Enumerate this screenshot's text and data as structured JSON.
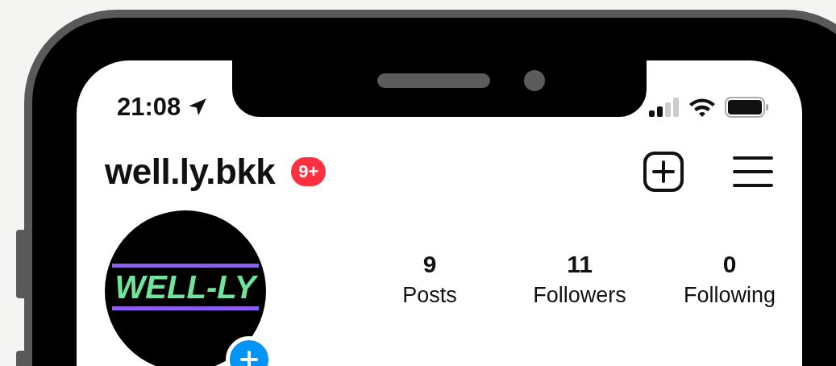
{
  "status_bar": {
    "time": "21:08"
  },
  "header": {
    "username": "well.ly.bkk",
    "badge": "9+"
  },
  "profile": {
    "avatar_logo": "WELL-LY"
  },
  "stats": [
    {
      "value": "9",
      "label": "Posts"
    },
    {
      "value": "11",
      "label": "Followers"
    },
    {
      "value": "0",
      "label": "Following"
    }
  ]
}
